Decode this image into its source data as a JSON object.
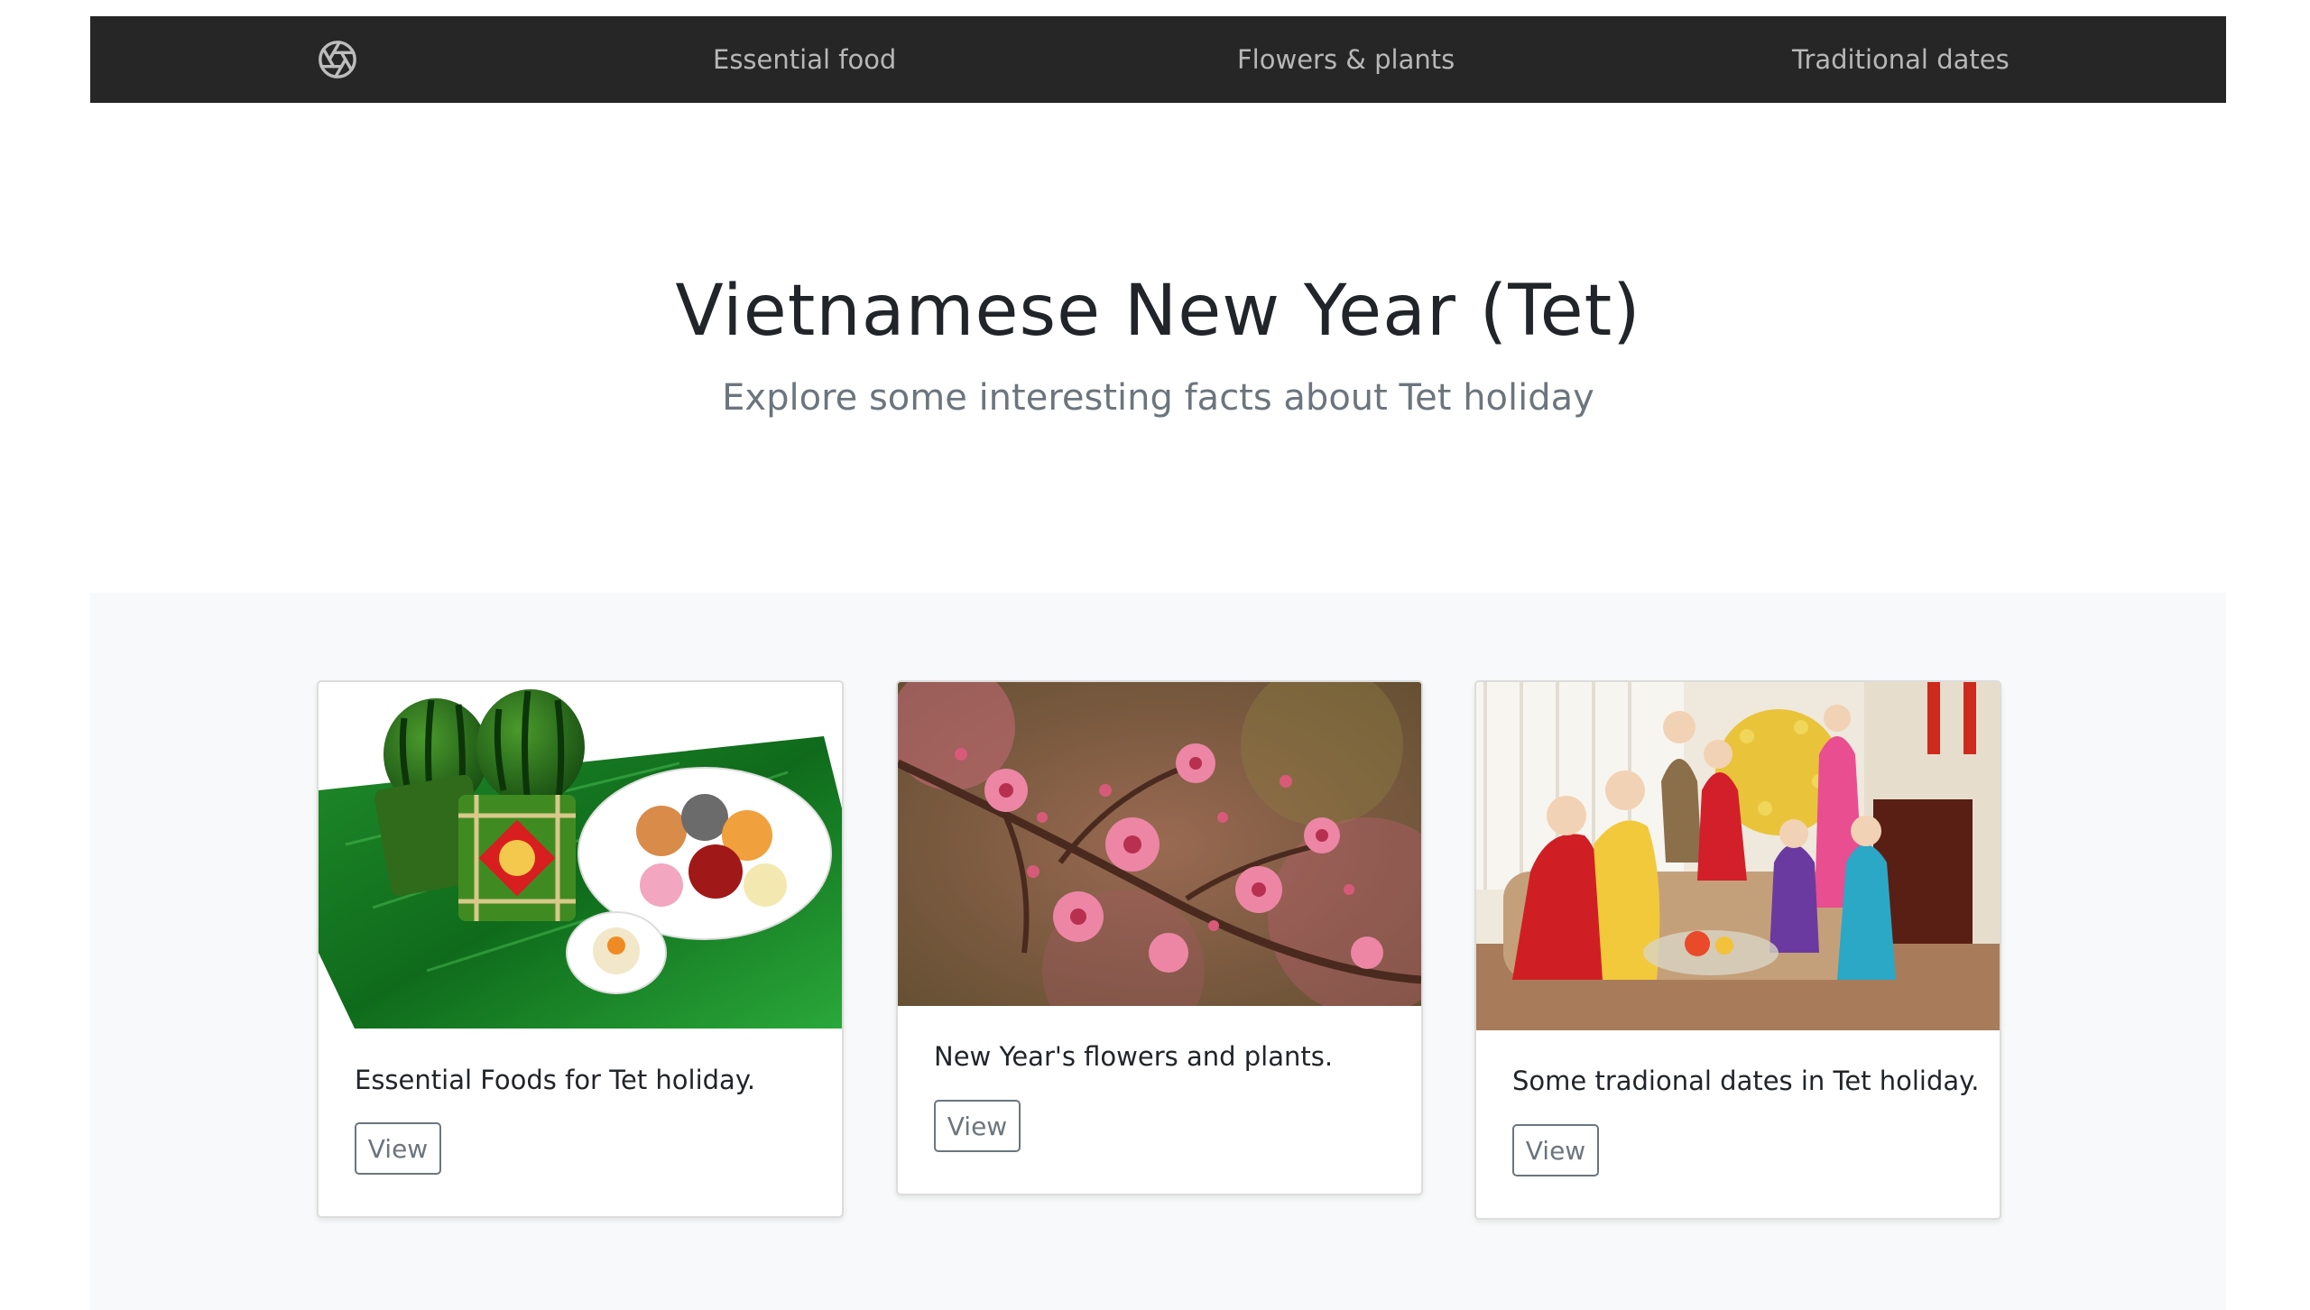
{
  "nav": {
    "logo_icon": "aperture-icon",
    "links": [
      {
        "label": "Essential food"
      },
      {
        "label": "Flowers & plants"
      },
      {
        "label": "Traditional dates"
      }
    ]
  },
  "hero": {
    "title": "Vietnamese New Year (Tet)",
    "subtitle": "Explore some interesting facts about Tet holiday"
  },
  "cards": [
    {
      "image": "banh-chung-watermelon-food-photo",
      "text": "Essential Foods for Tet holiday.",
      "button": "View"
    },
    {
      "image": "peach-blossom-photo",
      "text": "New Year's flowers and plants.",
      "button": "View"
    },
    {
      "image": "family-celebrating-tet-photo",
      "text": "Some tradional dates in Tet holiday.",
      "button": "View"
    }
  ],
  "colors": {
    "navbar_bg": "#262626",
    "nav_text": "#b7b7b7",
    "album_bg": "#f8f9fa",
    "subtitle": "#6c757d"
  }
}
